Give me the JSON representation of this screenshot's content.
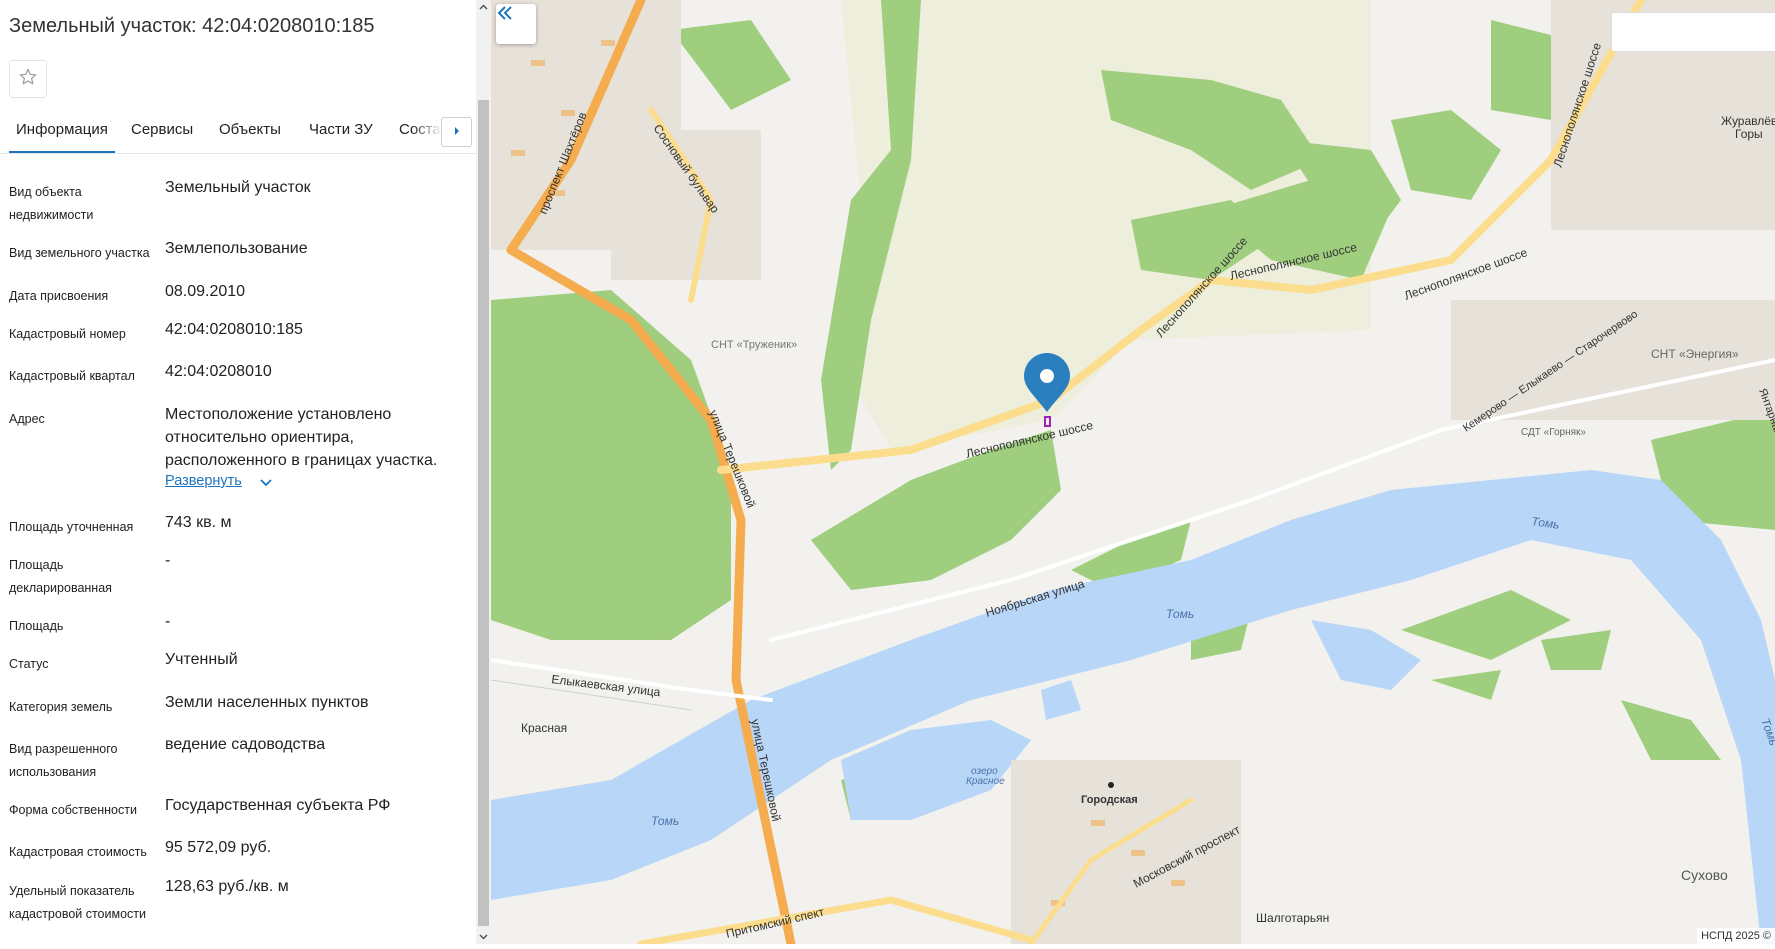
{
  "panel": {
    "title": "Земельный участок: 42:04:0208010:185",
    "tabs": [
      "Информация",
      "Сервисы",
      "Объекты",
      "Части ЗУ",
      "Состав"
    ],
    "active_tab": "Информация",
    "expand_label": "Развернуть",
    "fields": [
      {
        "label": "Вид объекта недвижимости",
        "value": "Земельный участок"
      },
      {
        "label": "Вид земельного участка",
        "value": "Землепользование"
      },
      {
        "label": "Дата присвоения",
        "value": "08.09.2010"
      },
      {
        "label": "Кадастровый номер",
        "value": "42:04:0208010:185"
      },
      {
        "label": "Кадастровый квартал",
        "value": "42:04:0208010"
      },
      {
        "label": "Адрес",
        "value": "Местоположение установлено относительно ориентира, расположенного в границах участка."
      },
      {
        "label": "Площадь уточненная",
        "value": "743 кв. м"
      },
      {
        "label": "Площадь декларированная",
        "value": "-"
      },
      {
        "label": "Площадь",
        "value": "-"
      },
      {
        "label": "Статус",
        "value": "Учтенный"
      },
      {
        "label": "Категория земель",
        "value": "Земли населенных пунктов"
      },
      {
        "label": "Вид разрешенного использования",
        "value": "ведение садоводства"
      },
      {
        "label": "Форма собственности",
        "value": "Государственная субъекта РФ"
      },
      {
        "label": "Кадастровая стоимость",
        "value": "95 572,09 руб."
      },
      {
        "label": "Удельный показатель кадастровой стоимости",
        "value": "128,63 руб./кв. м"
      }
    ]
  },
  "map": {
    "attribution": "НСПД 2025 ©",
    "labels": {
      "shakhterov": "проспект Шахтёров",
      "sosnovy": "Сосновый бульвар",
      "truzhenik": "СНТ «Труженик»",
      "tereshkovoy1": "улица Терешковой",
      "tereshkovoy2": "улица Терешковой",
      "lesnopol1": "Леснополянское шоссе",
      "lesnopol2": "Леснополянское шоссе",
      "lesnopol3": "Леснополянское шоссе",
      "lesnopol4": "Леснополянское шоссе",
      "lesnopol5": "Леснополянское шоссе",
      "zhuravlevy1": "Журавлёвы",
      "zhuravlevy2": "Горы",
      "energiya": "СНТ «Энергия»",
      "gornyak": "СДТ «Горняк»",
      "kemerovo": "Кемерово — Елыкаево — Старочервово",
      "yantarnaya": "Янтарная улица",
      "tom1": "Томь",
      "tom2": "Томь",
      "tom3": "Томь",
      "tom4": "Томь",
      "noyabrskaya": "Ноябрьская улица",
      "elykaevskaya": "Елыкаевская улица",
      "krasnaya": "Красная",
      "ozero1": "озеро",
      "ozero2": "Красное",
      "gorodskaya": "Городская",
      "moskovsky": "Московский проспект",
      "shalgotaryan": "Шалготарьян",
      "pritomsky": "Притомский спект",
      "sukhovo": "Сухово"
    }
  },
  "colors": {
    "accent": "#1e73be",
    "forest": "#9fce7f",
    "water": "#b8d6f7",
    "major_road": "#f5ac4e",
    "secondary_road": "#fbdd8d",
    "marker": "#2c7fbf"
  }
}
